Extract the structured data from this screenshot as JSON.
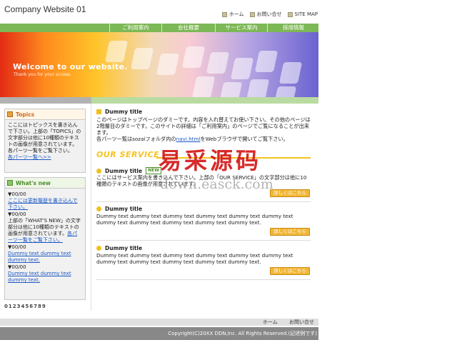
{
  "site": {
    "title": "Company Website 01"
  },
  "topnav": [
    {
      "label": "ホーム"
    },
    {
      "label": "お問い合せ"
    },
    {
      "label": "SITE MAP"
    }
  ],
  "mainnav": [
    {
      "label": "ご利用案内"
    },
    {
      "label": "会社概要"
    },
    {
      "label": "サービス案内"
    },
    {
      "label": "採用情報"
    }
  ],
  "hero": {
    "title": "Welcome to our website.",
    "subtitle": "Thank you for your access."
  },
  "sidebar": {
    "topics": {
      "heading": "Topics",
      "text": "ここにはトピックスを書き込んで下さい。上部の「TOPICS」の文字部分は他に10種類のテキストの画像が用意されています。各パーツ一覧をご覧下さい。",
      "link": "各パーツ一覧へ>>"
    },
    "whats_new": {
      "heading": "What's new",
      "items": [
        {
          "date": "▼00/00",
          "text": "ここには更新履歴を書き込んで下さい。",
          "link": true
        },
        {
          "date": "▼00/00",
          "text": "上部の「WHAT'S NEW」の文字部分は他に10種類のテキストの画像が用意されています。",
          "tail": "各パーツ一覧をご覧下さい。",
          "link": false
        },
        {
          "date": "▼00/00",
          "text": "Dummy text dummy text dummy text.",
          "link": true
        },
        {
          "date": "▼00/00",
          "text": "Dummy text dummy text dummy text.",
          "link": true
        }
      ]
    },
    "phone": "0123456789"
  },
  "main": {
    "intro": {
      "title": "Dummy title",
      "text1": "このページはトップページのダミーです。内容を入れ替えてお使い下さい。その他のページは2階層目のダミーです。このサイトの詳細は「ご利用案内」のページでご覧になることが出来ます。",
      "text2_pre": "各パーツ一覧はsozaiフォルダ内の",
      "text2_link": "navi.html",
      "text2_post": "をWebブラウザで開いてご覧下さい。"
    },
    "service_banner": "OUR SERVICE",
    "items": [
      {
        "title": "Dummy title",
        "badge": "NEW",
        "text": "ここにはサービス案内を書き込んで下さい。上部の「OUR SERVICE」の文字部分は他に10種類のテキストの画像が用意されています。",
        "button": "詳しくはこちら"
      },
      {
        "title": "Dummy title",
        "badge": "",
        "text": "Dummy text dummy text dummy text dummy text dummy text dummy text dummy text dummy text dummy text dummy text dummy text.",
        "button": "詳しくはこちら"
      },
      {
        "title": "Dummy title",
        "badge": "",
        "text": "Dummy text dummy text dummy text dummy text dummy text dummy text dummy text dummy text dummy text dummy text dummy text.",
        "button": "詳しくはこちら"
      }
    ]
  },
  "watermark": {
    "cn": "易采源码",
    "url": "down.easck.com"
  },
  "footer": {
    "links": [
      {
        "label": "ホーム"
      },
      {
        "label": "お問い合せ"
      }
    ],
    "copyright": "Copyright(C)20XX DDN,Inc. All Rights Reserved.(記述例です)"
  },
  "colors": {
    "nav_green": "#7cb855",
    "accent_orange": "#f2b737",
    "link_blue": "#1a56c4"
  }
}
